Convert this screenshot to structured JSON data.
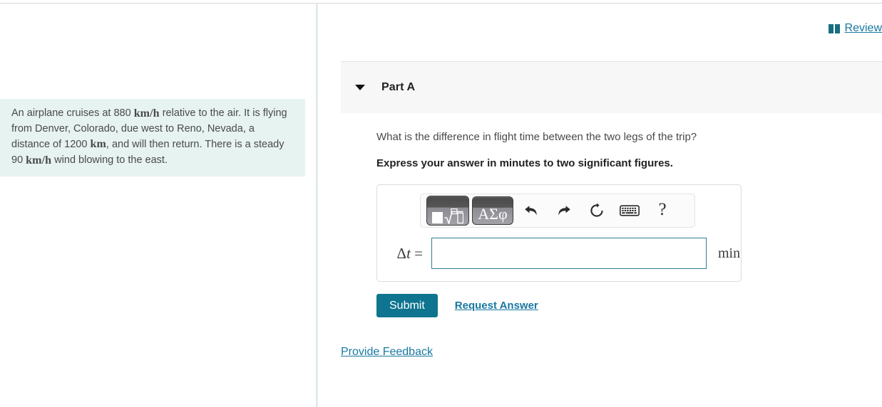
{
  "page": {
    "review": {
      "icon": "book-icon",
      "label": "Review"
    }
  },
  "problem": {
    "segments": [
      {
        "type": "text",
        "value": "An airplane cruises at 880 "
      },
      {
        "type": "unit",
        "value": "km/h"
      },
      {
        "type": "text",
        "value": " relative to the air. It is flying from Denver, Colorado, due west to Reno, Nevada, a distance of 1200 "
      },
      {
        "type": "unit",
        "value": "km"
      },
      {
        "type": "text",
        "value": ", and will then return. There is a steady 90 "
      },
      {
        "type": "unit",
        "value": "km/h"
      },
      {
        "type": "text",
        "value": " wind blowing to the east."
      }
    ],
    "text_plain": "An airplane cruises at 880 km/h relative to the air. It is flying from Denver, Colorado, due west to Reno, Nevada, a distance of 1200 km, and will then return. There is a steady 90 km/h wind blowing to the east.",
    "speed_air": "880",
    "speed_air_unit": "km/h",
    "distance": "1200",
    "distance_unit": "km",
    "wind_speed": "90",
    "wind_speed_unit": "km/h",
    "background_color": "#e6f3f1"
  },
  "part": {
    "caret_icon": "caret-down-icon",
    "title": "Part A",
    "question": "What is the difference in flight time between the two legs of the trip?",
    "instruction": "Express your answer in minutes to two significant figures."
  },
  "answer_widget": {
    "toolbar": {
      "buttons": [
        {
          "name": "math-template-button",
          "label": "",
          "icon": "square-root-template-icon"
        },
        {
          "name": "greek-symbols-button",
          "label": "ΑΣφ",
          "icon": "greek-letters-icon"
        },
        {
          "name": "undo-button",
          "label": "",
          "icon": "undo-icon"
        },
        {
          "name": "redo-button",
          "label": "",
          "icon": "redo-icon"
        },
        {
          "name": "reset-button",
          "label": "",
          "icon": "reset-circular-arrow-icon"
        },
        {
          "name": "keyboard-button",
          "label": "",
          "icon": "keyboard-icon"
        },
        {
          "name": "help-button",
          "label": "?",
          "icon": "question-mark-icon"
        }
      ],
      "greek_label": "ΑΣφ",
      "help_label": "?"
    },
    "variable_label_delta": "Δ",
    "variable_label_t": "t",
    "variable_label_equals": "=",
    "input_value": "",
    "input_placeholder": "",
    "unit": "min",
    "input_border_color": "#2e7e96"
  },
  "actions": {
    "submit_label": "Submit",
    "submit_color": "#0e7490",
    "request_answer_label": "Request Answer"
  },
  "footer": {
    "provide_feedback_label": "Provide Feedback",
    "link_color": "#1878a0"
  }
}
